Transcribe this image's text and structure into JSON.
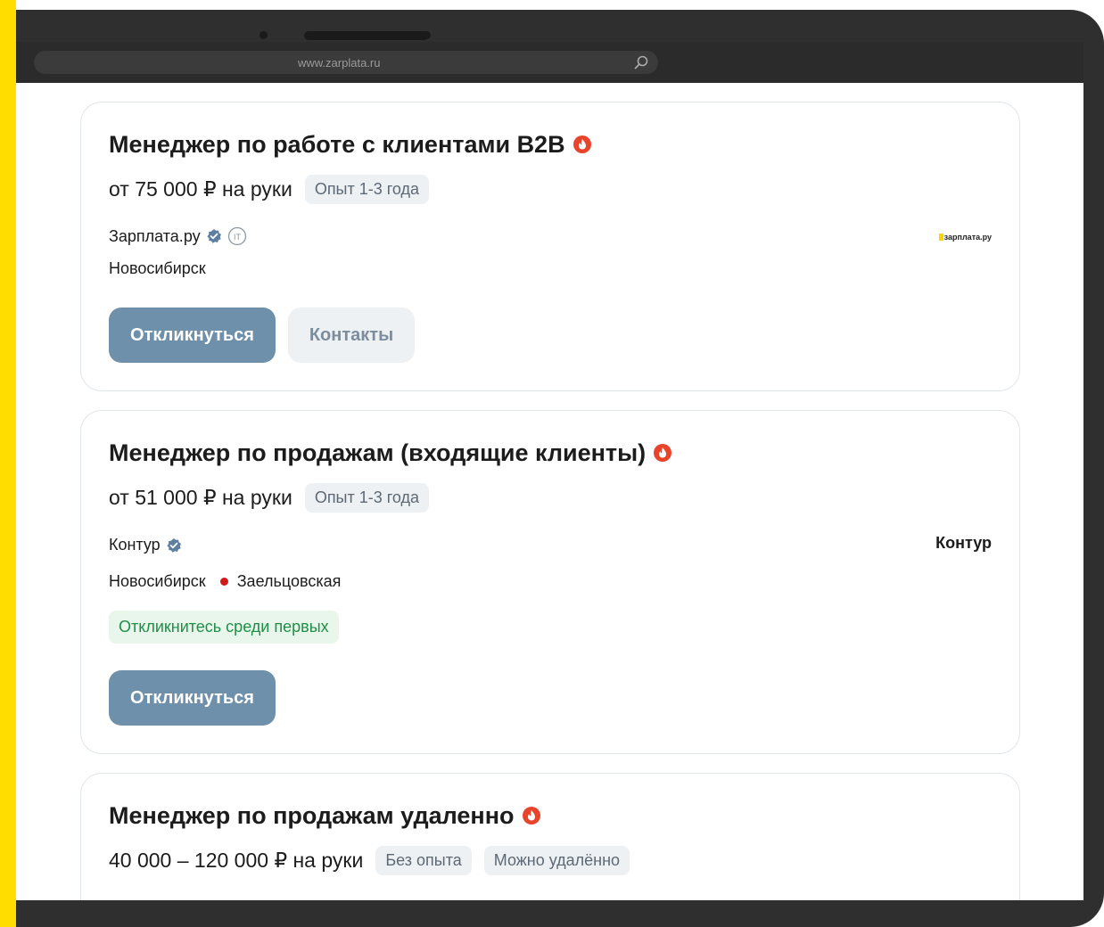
{
  "browser": {
    "url": "www.zarplata.ru"
  },
  "vacancies": [
    {
      "title": "Менеджер по работе с клиентами B2B",
      "salary": "от 75 000 ₽ на руки",
      "tags": [
        "Опыт 1-3 года"
      ],
      "company": "Зарплата.ру",
      "company_badge": "IT",
      "logo_text": "зарплата.ру",
      "city": "Новосибирск",
      "primary_button": "Откликнуться",
      "secondary_button": "Контакты"
    },
    {
      "title": "Менеджер по продажам (входящие клиенты)",
      "salary": "от 51 000 ₽ на руки",
      "tags": [
        "Опыт 1-3 года"
      ],
      "company": "Контур",
      "logo_text": "Контур",
      "city": "Новосибирск",
      "metro": "Заельцовская",
      "badge": "Откликнитесь среди первых",
      "primary_button": "Откликнуться"
    },
    {
      "title": "Менеджер по продажам удаленно",
      "salary": "40 000 – 120 000 ₽ на руки",
      "tags": [
        "Без опыта",
        "Можно удалённо"
      ]
    }
  ],
  "colors": {
    "accent_button": "#6f90ab",
    "hot_icon": "#e8432b",
    "verified_icon": "#5e7fa0",
    "metro_dot": "#d01a1a",
    "side_strip": "#ffdd00"
  },
  "icons": [
    "search-icon",
    "fire-icon",
    "verified-icon",
    "it-badge-icon"
  ]
}
